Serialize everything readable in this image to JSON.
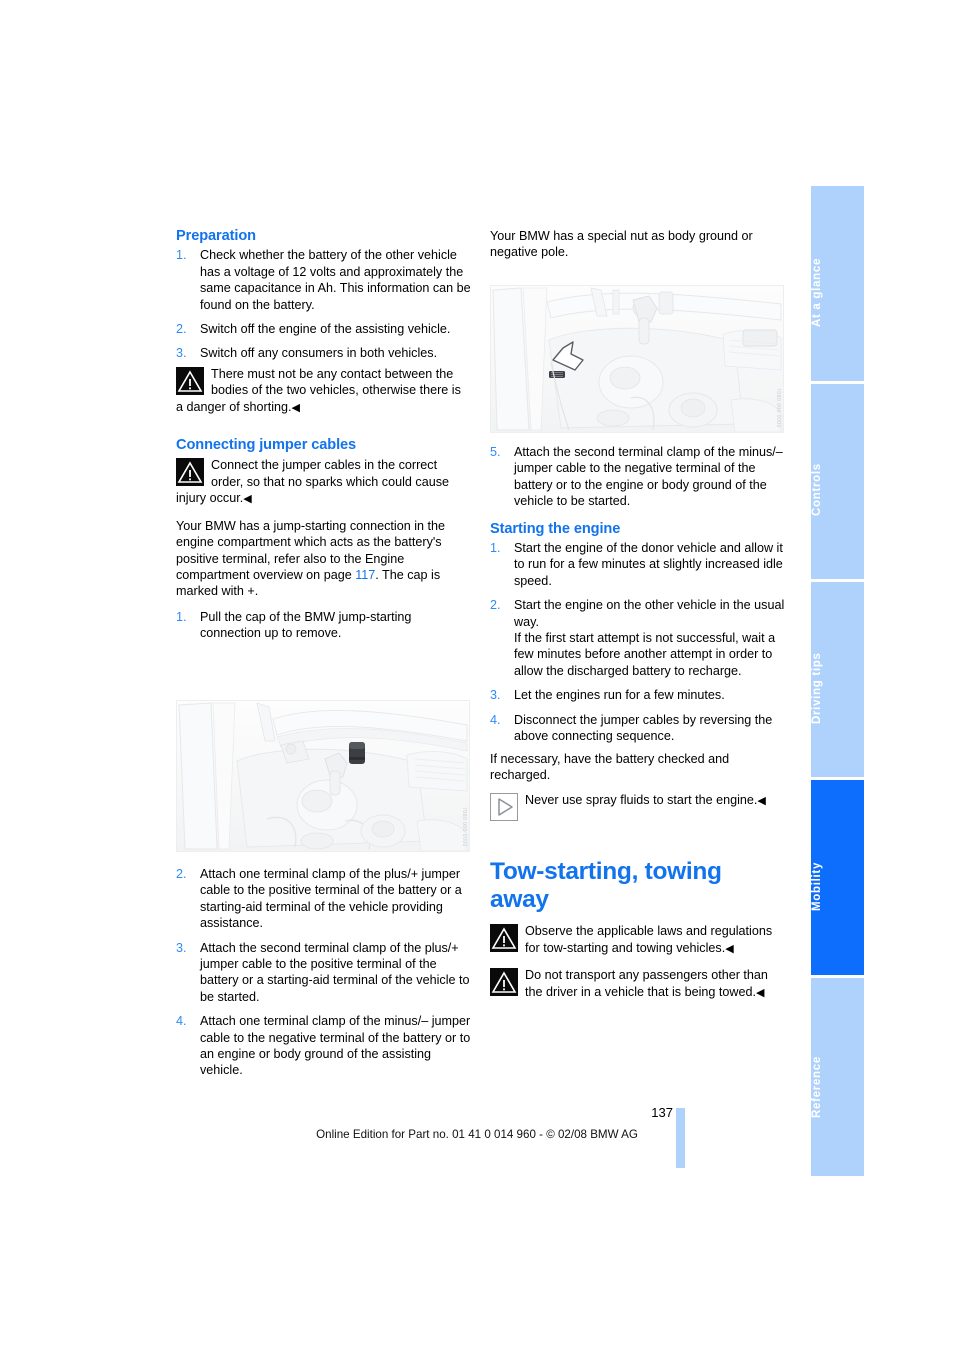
{
  "document": {
    "type": "bmw-owners-manual-page",
    "page_number": "137",
    "footer": "Online Edition for Part no. 01 41 0 014 960 - © 02/08 BMW AG",
    "accent_blue": "#1273ee",
    "tab_active_blue": "#0d6efd",
    "tab_inactive_blue": "#aed2fc"
  },
  "side_tabs": [
    {
      "label": "At a glance",
      "active": false
    },
    {
      "label": "Controls",
      "active": false
    },
    {
      "label": "Driving tips",
      "active": false
    },
    {
      "label": "Mobility",
      "active": true
    },
    {
      "label": "Reference",
      "active": false
    }
  ],
  "left_column": {
    "preparation": {
      "heading": "Preparation",
      "steps": [
        {
          "num": "1.",
          "text": "Check whether the battery of the other vehicle has a voltage of 12 volts and approximately the same capacitance in Ah. This information can be found on the battery."
        },
        {
          "num": "2.",
          "text": "Switch off the engine of the assisting vehicle."
        },
        {
          "num": "3.",
          "text": "Switch off any consumers in both vehicles."
        }
      ],
      "warning": {
        "icon": "warning-triangle-icon",
        "text": "There must not be any contact between the bodies of the two vehicles, otherwise there is a danger of shorting.",
        "endmark": "◀"
      }
    },
    "connecting_jumper_cables": {
      "heading": "Connecting jumper cables",
      "warning": {
        "icon": "warning-triangle-icon",
        "text": "Connect the jumper cables in the correct order, so that no sparks which could cause injury occur.",
        "endmark": "◀"
      },
      "paragraph_before": "Your BMW has a jump-starting connection in the engine compartment which acts as the battery's positive terminal, refer also to the Engine compartment overview on page ",
      "page_reference": "117",
      "paragraph_after": ". The cap is marked with +.",
      "steps": [
        {
          "num": "1.",
          "text": "Pull the cap of the BMW jump-starting connection up to remove."
        },
        {
          "num": "2.",
          "text": "Attach one terminal clamp of the plus/+ jumper cable to the positive terminal of the battery or a starting-aid terminal of the vehicle providing assistance."
        },
        {
          "num": "3.",
          "text": "Attach the second terminal clamp of the plus/+ jumper cable to the positive terminal of the battery or a starting-aid terminal of the vehicle to be started."
        },
        {
          "num": "4.",
          "text": "Attach one terminal clamp of the minus/– jumper cable to the negative terminal of the battery or to an engine or body ground of the assisting vehicle."
        }
      ]
    },
    "figure": {
      "name": "engine-compartment-jump-start-connection-photo",
      "code": "7080 000 0000"
    }
  },
  "right_column": {
    "intro_paragraph": "Your BMW has a special nut as body ground or negative pole.",
    "figure": {
      "name": "engine-compartment-body-ground-photo",
      "code": "7080 000 0000"
    },
    "continued_steps": [
      {
        "num": "5.",
        "text": "Attach the second terminal clamp of the minus/– jumper cable to the negative terminal of the battery or to the engine or body ground of the vehicle to be started."
      }
    ],
    "starting_the_engine": {
      "heading": "Starting the engine",
      "steps": [
        {
          "num": "1.",
          "text": "Start the engine of the donor vehicle and allow it to run for a few minutes at slightly increased idle speed."
        },
        {
          "num": "2.",
          "text": "Start the engine on the other vehicle in the usual way.",
          "sub": "If the first start attempt is not successful, wait a few minutes before another attempt in order to allow the discharged battery to recharge."
        },
        {
          "num": "3.",
          "text": "Let the engines run for a few minutes."
        },
        {
          "num": "4.",
          "text": "Disconnect the jumper cables by reversing the above connecting sequence."
        }
      ],
      "paragraph": "If necessary, have the battery checked and recharged.",
      "note": {
        "icon": "note-triangle-icon",
        "text": "Never use spray fluids to start the engine.",
        "endmark": "◀"
      }
    },
    "tow_starting": {
      "heading": "Tow-starting, towing away",
      "warnings": [
        {
          "icon": "warning-triangle-icon",
          "text": "Observe the applicable laws and regulations for tow-starting and towing vehicles.",
          "endmark": "◀"
        },
        {
          "icon": "warning-triangle-icon",
          "text": "Do not transport any passengers other than the driver in a vehicle that is being towed.",
          "endmark": "◀"
        }
      ]
    }
  }
}
